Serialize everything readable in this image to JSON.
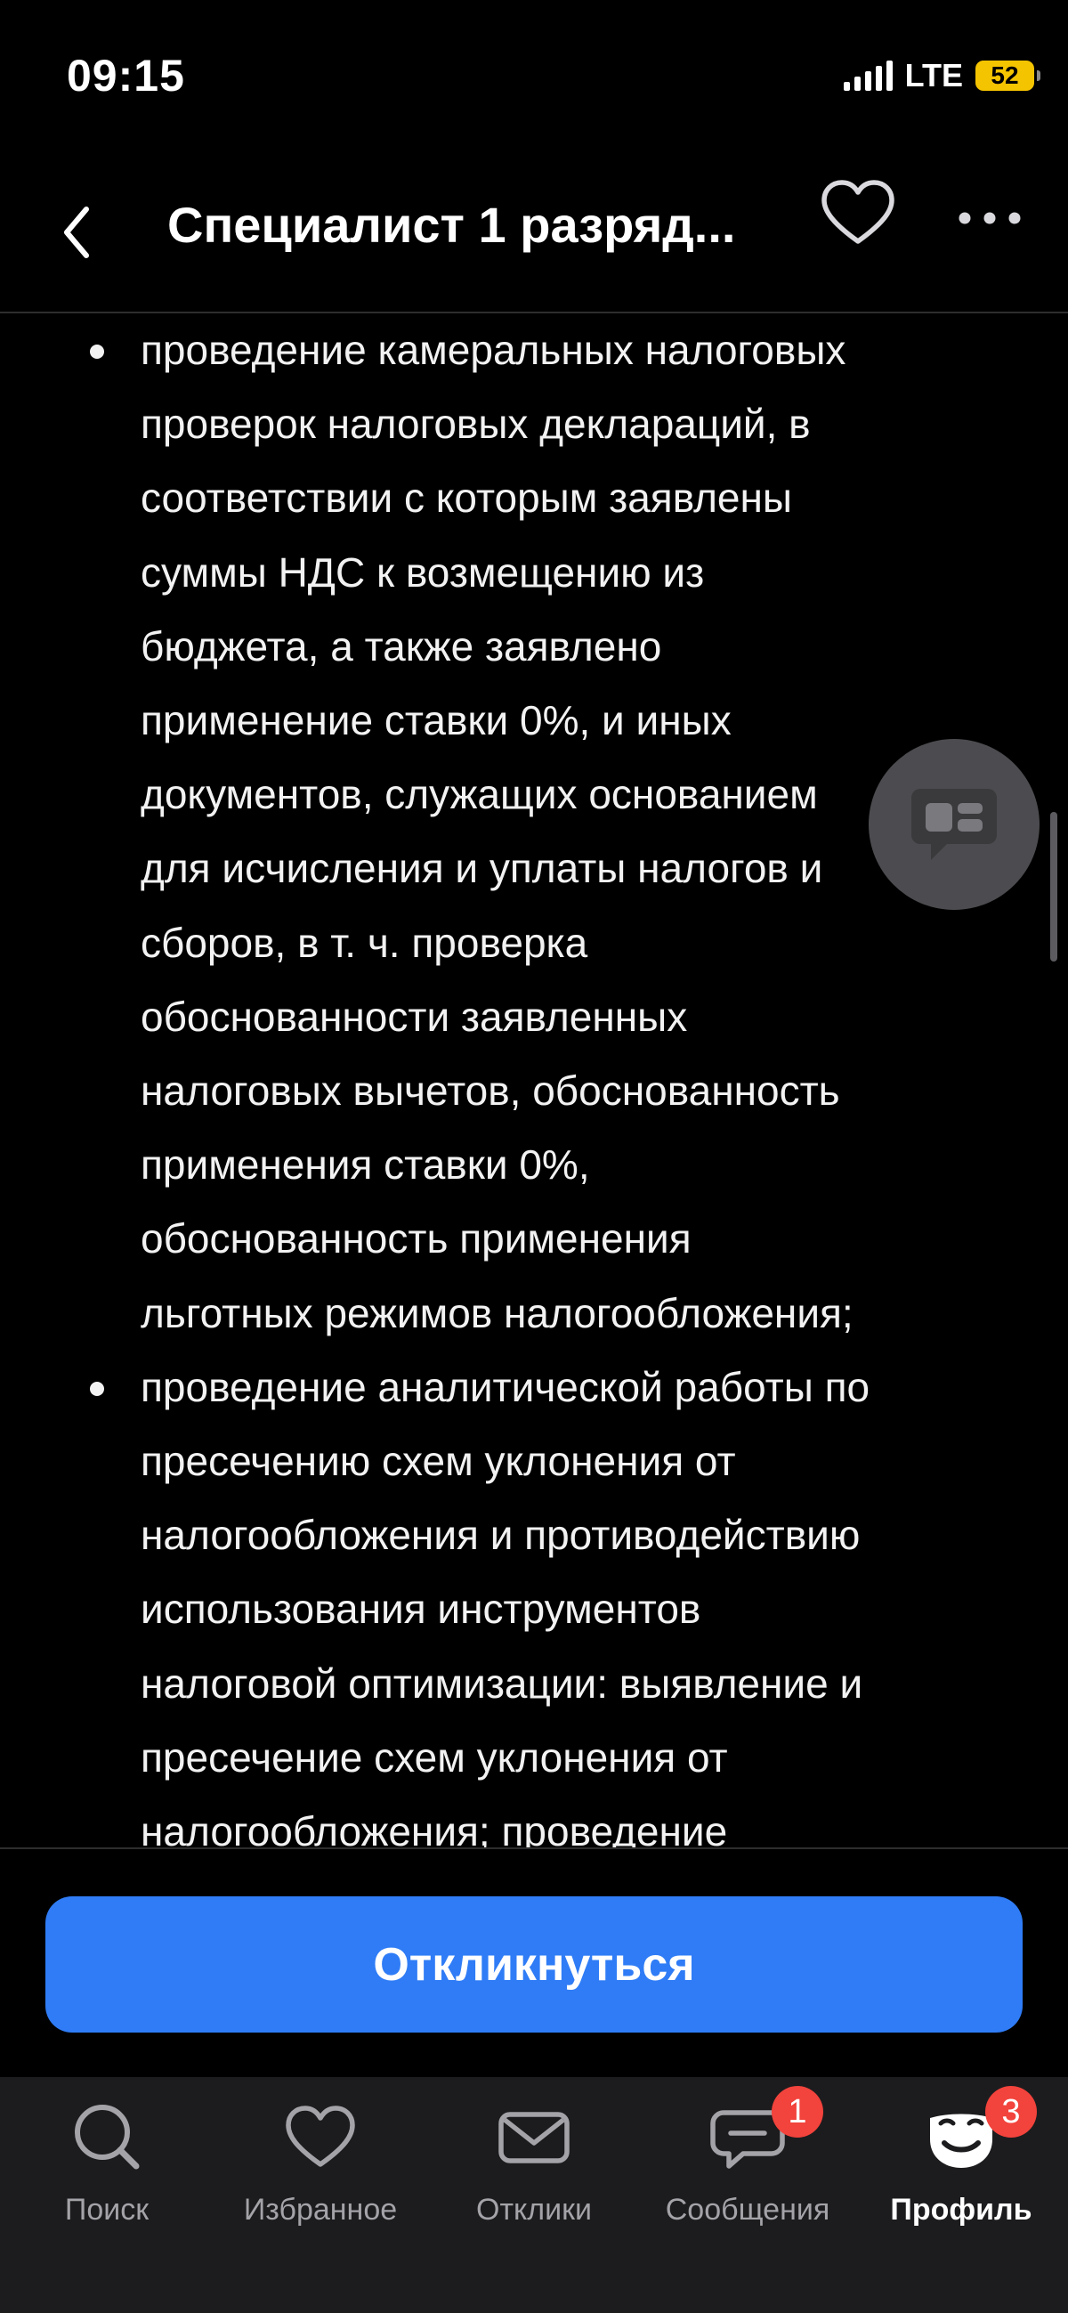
{
  "status_bar": {
    "time": "09:15",
    "network": "LTE",
    "battery": "52"
  },
  "header": {
    "title": "Специалист 1 разряд..."
  },
  "duties": [
    {
      "lines": [
        "проведение камеральных налоговых",
        "проверок налоговых деклараций, в",
        "соответствии с которым заявлены",
        "суммы НДС к возмещению из",
        "бюджета, а также заявлено",
        "применение ставки 0%, и иных",
        "документов, служащих основанием",
        "для исчисления и уплаты налогов и",
        "сборов, в т. ч. проверка",
        "обоснованности заявленных",
        "налоговых вычетов, обоснованность",
        "применения ставки 0%,",
        "обоснованность применения",
        "льготных режимов налогообложения;"
      ]
    },
    {
      "lines": [
        "проведение аналитической работы по",
        "пресечению схем уклонения от",
        "налогообложения и противодействию",
        "использования инструментов",
        "налоговой оптимизации: выявление и",
        "пресечение схем уклонения от",
        "налогообложения; проведение"
      ]
    }
  ],
  "action": {
    "respond_label": "Откликнуться",
    "color": "#2f7cf6"
  },
  "tab_bar": {
    "tabs": [
      {
        "label": "Поиск",
        "icon": "search-icon",
        "badge": null,
        "active": false
      },
      {
        "label": "Избранное",
        "icon": "heart-icon",
        "badge": null,
        "active": false
      },
      {
        "label": "Отклики",
        "icon": "envelope-icon",
        "badge": null,
        "active": false
      },
      {
        "label": "Сообщения",
        "icon": "chat-bubble-icon",
        "badge": "1",
        "active": false
      },
      {
        "label": "Профиль",
        "icon": "profile-icon",
        "badge": "3",
        "active": true
      }
    ]
  }
}
